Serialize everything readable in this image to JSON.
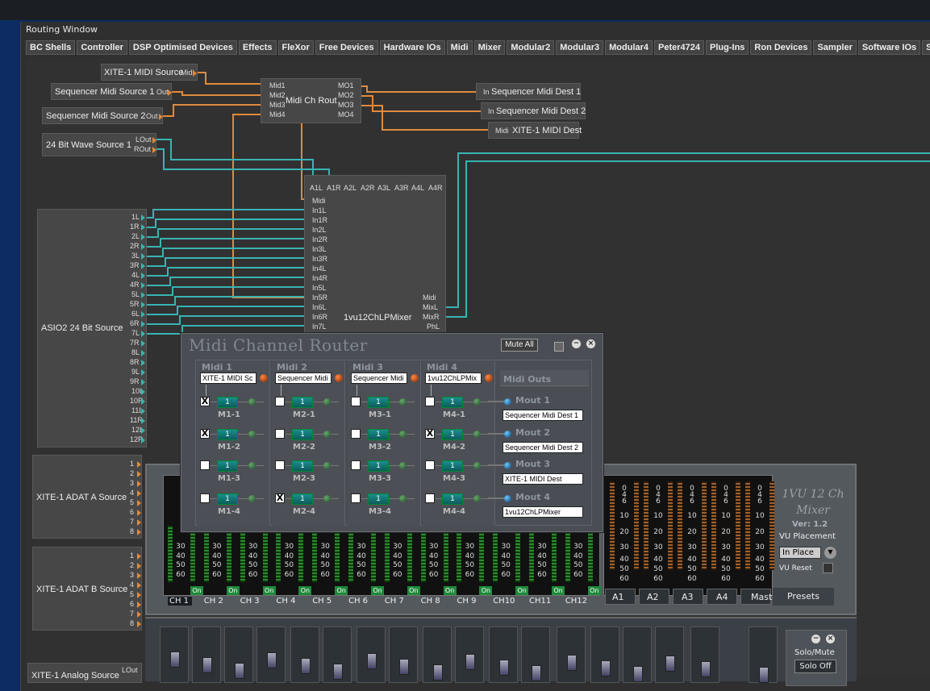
{
  "window": {
    "title": "Routing Window"
  },
  "tabs": [
    "BC Shells",
    "Controller",
    "DSP Optimised Devices",
    "Effects",
    "FleXor",
    "Free Devices",
    "Hardware IOs",
    "Midi",
    "Mixer",
    "Modular2",
    "Modular3",
    "Modular4",
    "Peter4724",
    "Plug-Ins",
    "Ron Devices",
    "Sampler",
    "Software IOs",
    "S"
  ],
  "nodes": {
    "xite_midi_source": {
      "label": "XITE-1 MIDI Source",
      "port": "Midi"
    },
    "seq_src1": {
      "label": "Sequencer Midi Source 1",
      "port": "Out"
    },
    "seq_src2": {
      "label": "Sequencer Midi Source 2",
      "port": "Out"
    },
    "wave_src": {
      "label": "24 Bit Wave Source 1",
      "ports": [
        "LOut",
        "ROut"
      ]
    },
    "midi_ch_rout": {
      "label": "Midi Ch Rout",
      "in_ports": [
        "Mid1",
        "Mid2",
        "Mid3",
        "Mid4"
      ],
      "out_ports": [
        "MO1",
        "MO2",
        "MO3",
        "MO4"
      ]
    },
    "seq_dest1": {
      "label": "Sequencer Midi Dest 1",
      "port": "In"
    },
    "seq_dest2": {
      "label": "Sequencer Midi Dest 2",
      "port": "In"
    },
    "xite_midi_dest": {
      "label": "XITE-1 MIDI Dest",
      "port": "Midi"
    },
    "mixer_node": {
      "label": "1vu12ChLPMixer",
      "top_ports": [
        "A1L",
        "A1R",
        "A2L",
        "A2R",
        "A3L",
        "A3R",
        "A4L",
        "A4R"
      ],
      "in_ports": [
        "Midi",
        "In1L",
        "In1R",
        "In2L",
        "In2R",
        "In3L",
        "In3R",
        "In4L",
        "In4R",
        "In5L",
        "In5R",
        "In6L",
        "In6R",
        "In7L"
      ],
      "out_ports": [
        "Midi",
        "MixL",
        "MixR",
        "PhL"
      ]
    },
    "asio": {
      "label": "ASIO2 24 Bit Source",
      "ports": [
        "1L",
        "1R",
        "2L",
        "2R",
        "3L",
        "3R",
        "4L",
        "4R",
        "5L",
        "5R",
        "6L",
        "6R",
        "7L",
        "7R",
        "8L",
        "8R",
        "9L",
        "9R",
        "10L",
        "10R",
        "11L",
        "11R",
        "12L",
        "12R"
      ]
    },
    "adat_a": {
      "label": "XITE-1 ADAT A Source",
      "ports": [
        "1",
        "2",
        "3",
        "4",
        "5",
        "6",
        "7",
        "8"
      ]
    },
    "adat_b": {
      "label": "XITE-1 ADAT B Source",
      "ports": [
        "1",
        "2",
        "3",
        "4",
        "5",
        "6",
        "7",
        "8"
      ]
    },
    "analog": {
      "label": "XITE-1 Analog Source",
      "port": "LOut"
    }
  },
  "router": {
    "title": "Midi Channel Router",
    "mute_all": "Mute All",
    "columns": [
      {
        "header": "Midi 1",
        "input": "XITE-1 MIDI Sc",
        "slots": [
          "M1-1",
          "M1-2",
          "M1-3",
          "M1-4"
        ],
        "checked": [
          true,
          true,
          false,
          false
        ]
      },
      {
        "header": "Midi 2",
        "input": "Sequencer Midi",
        "slots": [
          "M2-1",
          "M2-2",
          "M2-3",
          "M2-4"
        ],
        "checked": [
          false,
          false,
          false,
          true
        ]
      },
      {
        "header": "Midi 3",
        "input": "Sequencer Midi",
        "slots": [
          "M3-1",
          "M3-2",
          "M3-3",
          "M3-4"
        ],
        "checked": [
          false,
          false,
          false,
          false
        ]
      },
      {
        "header": "Midi 4",
        "input": "1vu12ChLPMix",
        "slots": [
          "M4-1",
          "M4-2",
          "M4-3",
          "M4-4"
        ],
        "checked": [
          false,
          true,
          false,
          false
        ]
      }
    ],
    "channel_value": "1",
    "outs_header": "Midi Outs",
    "outs": [
      {
        "label": "Mout 1",
        "value": "Sequencer Midi Dest 1"
      },
      {
        "label": "Mout 2",
        "value": "Sequencer Midi Dest 2"
      },
      {
        "label": "Mout 3",
        "value": "XITE-1 MIDI Dest"
      },
      {
        "label": "Mout 4",
        "value": "1vu12ChLPMixer"
      }
    ]
  },
  "mixer": {
    "title": "1VU 12 Ch Mixer",
    "version": "Ver: 1.2",
    "vu_placement_label": "VU Placement",
    "vu_placement_value": "In Place",
    "vu_reset": "VU Reset",
    "presets": "Presets",
    "on_label": "On",
    "channels": [
      "CH 1",
      "CH 2",
      "CH 3",
      "CH 4",
      "CH 5",
      "CH 6",
      "CH 7",
      "CH 8",
      "CH 9",
      "CH10",
      "CH11",
      "CH12"
    ],
    "aux": [
      "A1",
      "A2",
      "A3",
      "A4",
      "Master"
    ],
    "scale_lower": [
      "30",
      "40",
      "50",
      "60"
    ],
    "scale_upper": [
      "0",
      "4",
      "6",
      "10",
      "20",
      "30",
      "40",
      "50",
      "60"
    ],
    "solo_mute": "Solo/Mute",
    "solo_off": "Solo Off"
  }
}
